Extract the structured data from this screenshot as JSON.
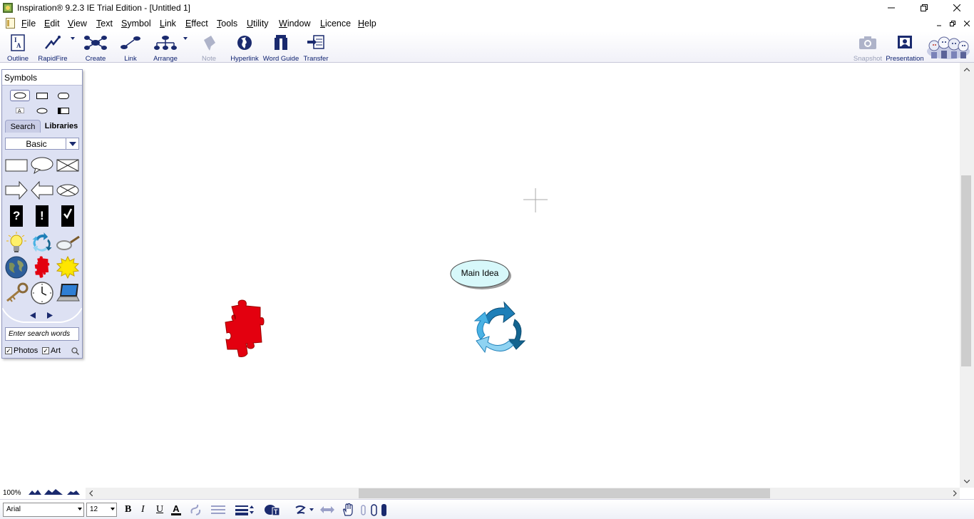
{
  "window": {
    "title": "Inspiration® 9.2.3 IE Trial Edition - [Untitled 1]"
  },
  "menubar": {
    "items": [
      "File",
      "Edit",
      "View",
      "Text",
      "Symbol",
      "Link",
      "Effect",
      "Tools",
      "Utility",
      "Window",
      "Licence",
      "Help"
    ]
  },
  "toolbar": {
    "outline": "Outline",
    "rapidfire": "RapidFire",
    "create": "Create",
    "link": "Link",
    "arrange": "Arrange",
    "note": "Note",
    "hyperlink": "Hyperlink",
    "word_guide": "Word Guide",
    "transfer": "Transfer",
    "snapshot": "Snapshot",
    "presentation": "Presentation"
  },
  "symbols_palette": {
    "title": "Symbols",
    "tabs": {
      "search": "Search",
      "libraries": "Libraries"
    },
    "library_selected": "Basic",
    "search_placeholder": "Enter search words",
    "photos_label": "Photos",
    "photos_checked": true,
    "art_label": "Art",
    "art_checked": true,
    "symbols": [
      "rectangle",
      "speech-bubble",
      "crossed-rectangle",
      "right-arrow",
      "left-arrow",
      "crossed-oval",
      "question-mark",
      "exclamation-mark",
      "check-mark",
      "light-bulb",
      "cycle-arrows",
      "magnifying-glass",
      "globe",
      "puzzle-piece",
      "sun",
      "key",
      "clock",
      "laptop"
    ]
  },
  "diagram": {
    "main_idea_label": "Main Idea",
    "colors": {
      "main_idea_fill": "#d7f8fa",
      "puzzle": "#e3000f",
      "cycle": "#1e7fb8"
    }
  },
  "status": {
    "zoom": "100%"
  },
  "format": {
    "font": "Arial",
    "size": "12",
    "bold": "B",
    "italic": "I",
    "underline": "U",
    "text_color": "A"
  }
}
